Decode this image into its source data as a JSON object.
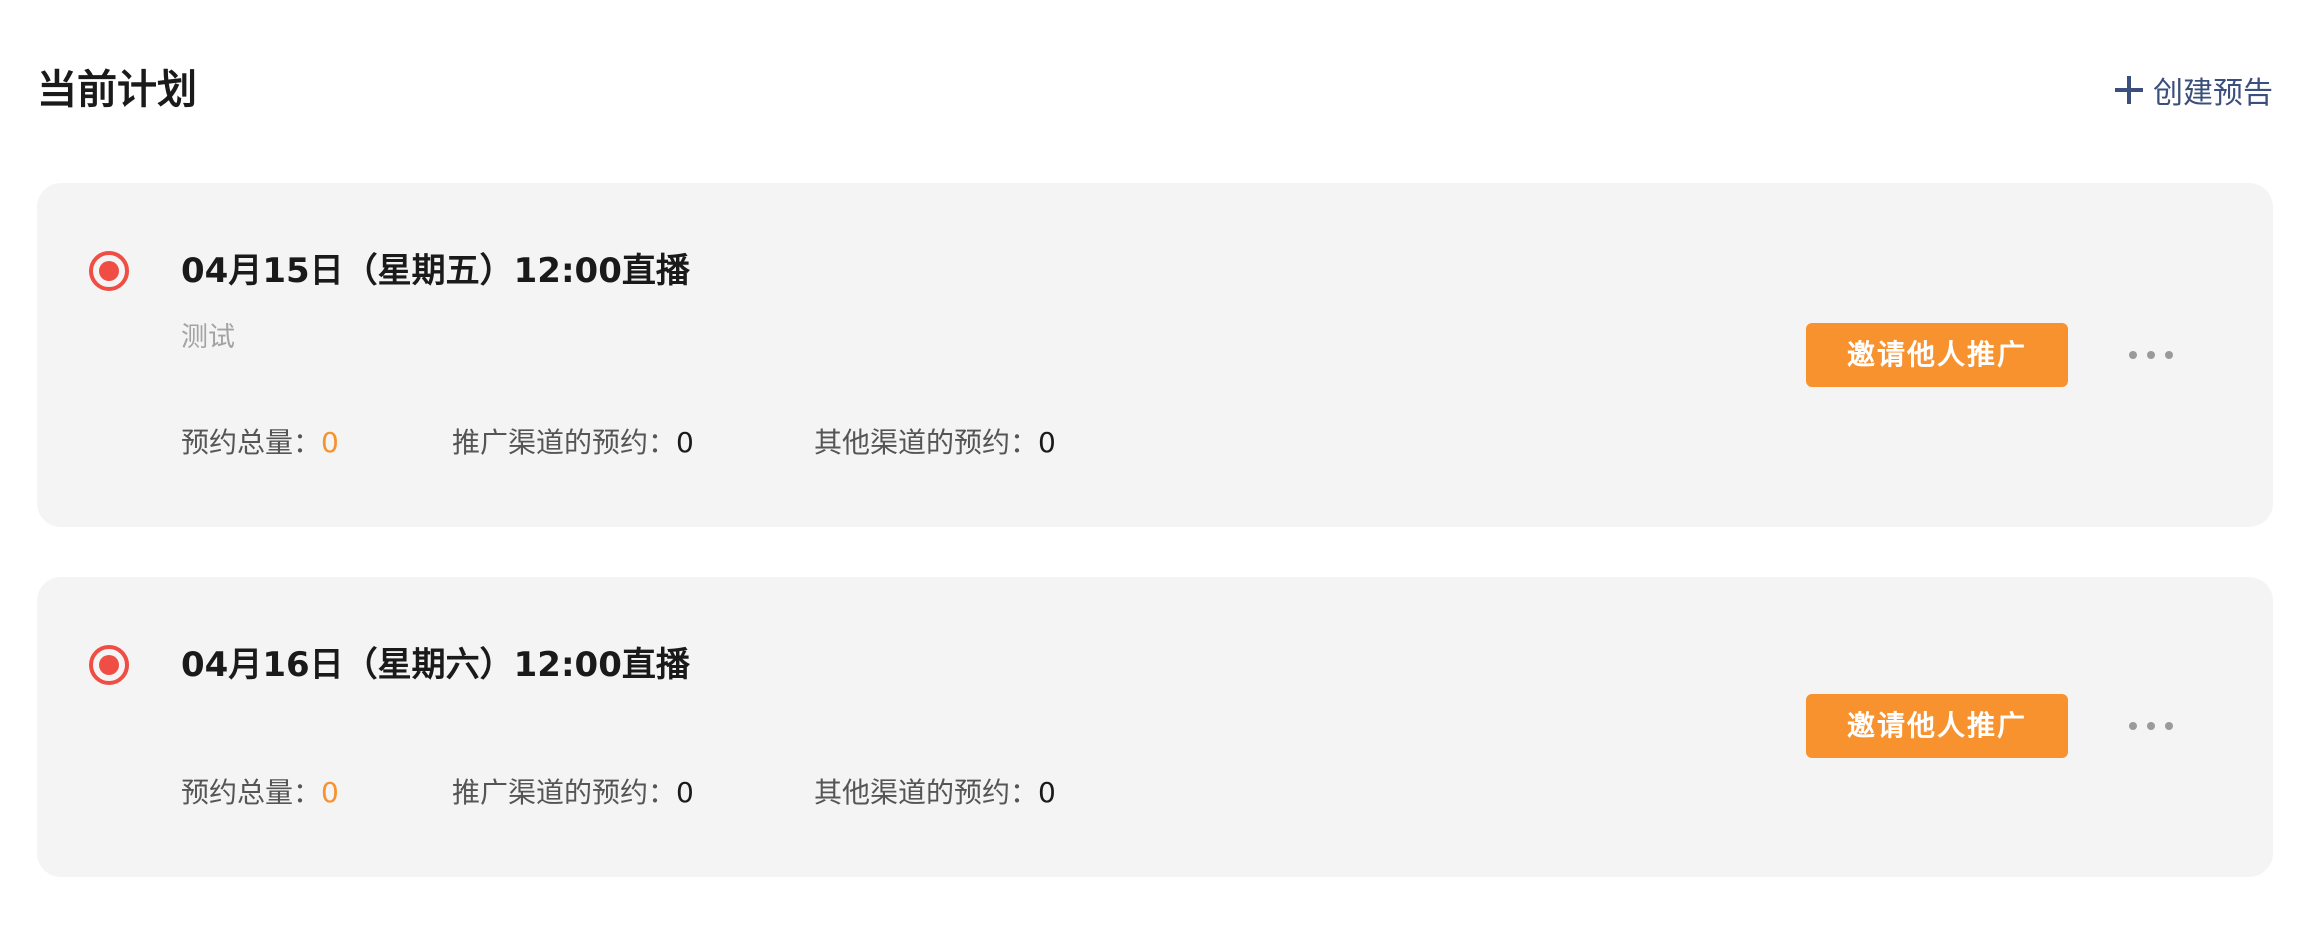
{
  "header": {
    "title": "当前计划",
    "create_label": "创建预告"
  },
  "plans": [
    {
      "title": "04月15日（星期五）12:00直播",
      "description": "测试",
      "total_label": "预约总量：",
      "total_value": "0",
      "promo_label": "推广渠道的预约：",
      "promo_value": "0",
      "other_label": "其他渠道的预约：",
      "other_value": "0",
      "invite_label": "邀请他人推广"
    },
    {
      "title": "04月16日（星期六）12:00直播",
      "total_label": "预约总量：",
      "total_value": "0",
      "promo_label": "推广渠道的预约：",
      "promo_value": "0",
      "other_label": "其他渠道的预约：",
      "other_value": "0",
      "invite_label": "邀请他人推广"
    }
  ],
  "colors": {
    "accent_orange": "#f7922f",
    "live_red": "#f04e44",
    "link_blue": "#3b4f7c",
    "card_bg": "#f4f4f4"
  },
  "icons": {
    "create": "plus-icon",
    "live": "live-record-icon",
    "more": "more-dots-icon"
  }
}
